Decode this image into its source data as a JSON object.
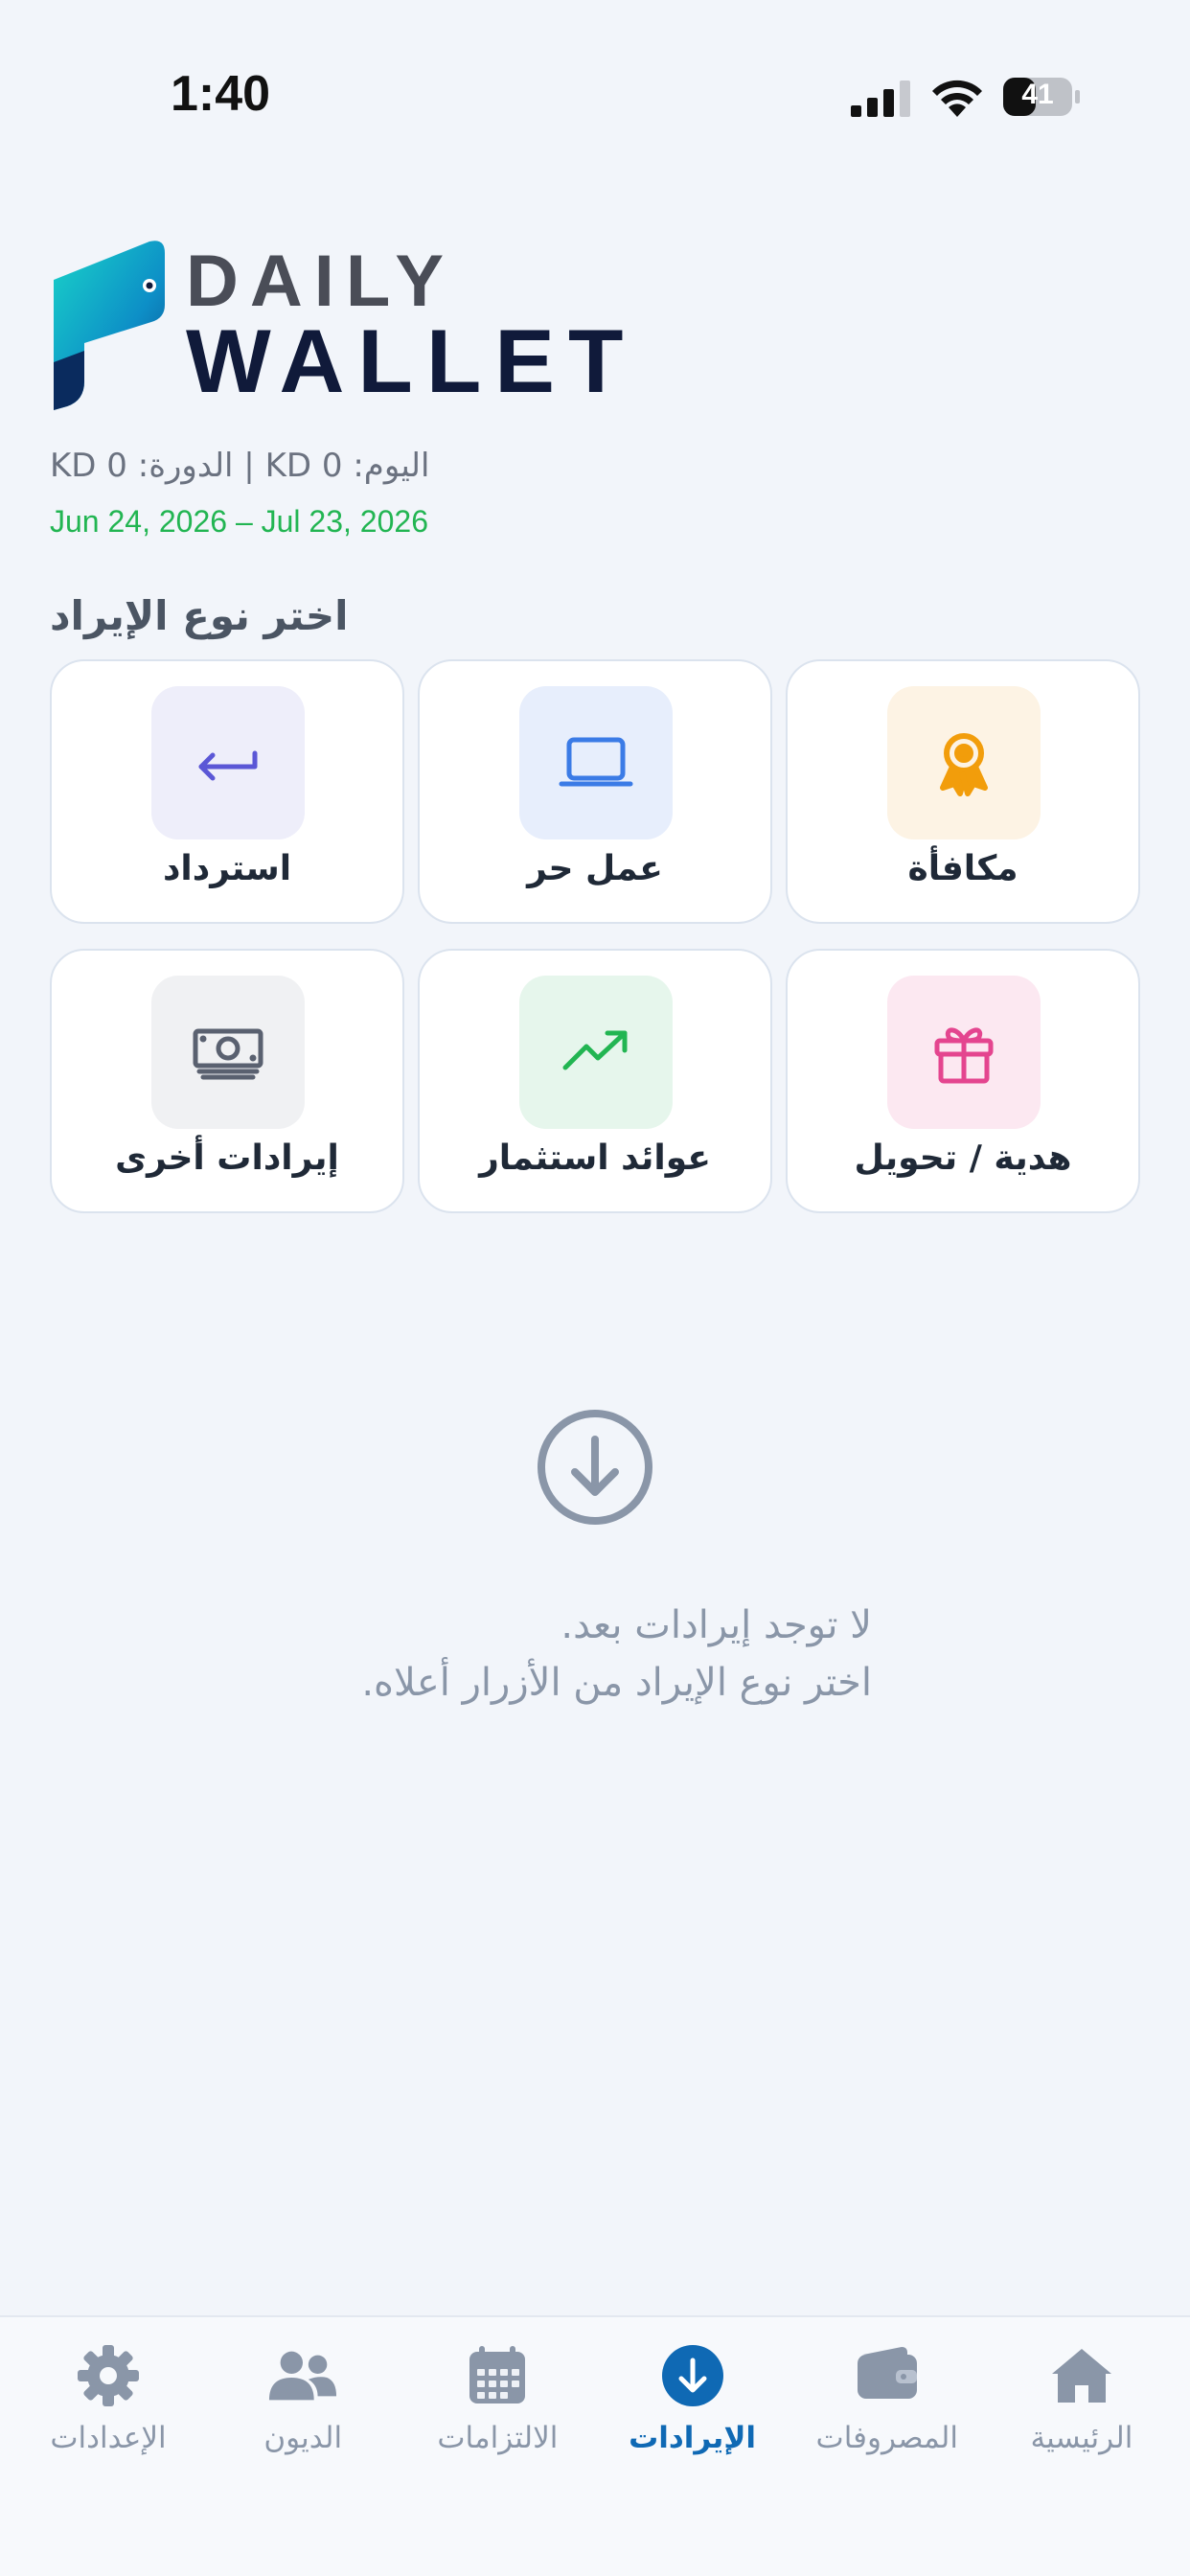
{
  "status_bar": {
    "time": "1:40",
    "battery": "41"
  },
  "brand": {
    "line1": "DAILY",
    "line2": "WALLET"
  },
  "summary": {
    "totals": "اليوم: 0 KD | الدورة: 0 KD",
    "period": "Jun 24, 2026 – Jul 23, 2026"
  },
  "section_title": "اختر نوع الإيراد",
  "income_types": [
    {
      "label": "مكافأة",
      "icon": "award-icon",
      "bg": "#fdf3e4",
      "color": "#f29d0b"
    },
    {
      "label": "عمل حر",
      "icon": "laptop-icon",
      "bg": "#e7eefc",
      "color": "#3b7be6"
    },
    {
      "label": "استرداد",
      "icon": "return-arrow-icon",
      "bg": "#eeeefa",
      "color": "#5b57d6"
    },
    {
      "label": "هدية / تحويل",
      "icon": "gift-icon",
      "bg": "#fce8f1",
      "color": "#e4458f"
    },
    {
      "label": "عوائد استثمار",
      "icon": "trending-up-icon",
      "bg": "#e6f6ec",
      "color": "#22b552"
    },
    {
      "label": "إيرادات أخرى",
      "icon": "cash-icon",
      "bg": "#f0f1f3",
      "color": "#5a6170"
    }
  ],
  "empty_state": {
    "line1": "لا توجد إيرادات بعد.",
    "line2": "اختر نوع الإيراد من الأزرار أعلاه."
  },
  "tabs": [
    {
      "label": "الرئيسية",
      "icon": "home-icon",
      "active": false
    },
    {
      "label": "المصروفات",
      "icon": "wallet-icon",
      "active": false
    },
    {
      "label": "الإيرادات",
      "icon": "income-arrow-icon",
      "active": true
    },
    {
      "label": "الالتزامات",
      "icon": "calendar-icon",
      "active": false
    },
    {
      "label": "الديون",
      "icon": "people-icon",
      "active": false
    },
    {
      "label": "الإعدادات",
      "icon": "gear-icon",
      "active": false
    }
  ],
  "colors": {
    "accent": "#0f69b4",
    "period": "#22b552",
    "muted": "#8a96a8",
    "background": "#f2f5fa"
  }
}
